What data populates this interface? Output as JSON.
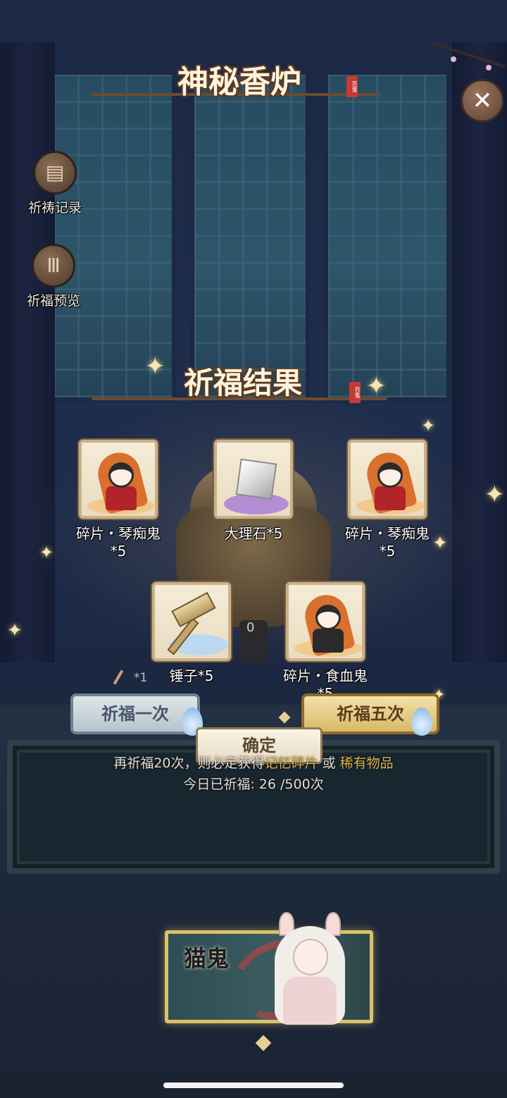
{
  "header": {
    "title": "神秘香炉",
    "seal_text": "百鬼",
    "close_label": "✕"
  },
  "side_menu": [
    {
      "id": "records",
      "label": "祈祷记录",
      "icon": "scroll-icon"
    },
    {
      "id": "preview",
      "label": "祈福预览",
      "icon": "incense-sticks-icon"
    }
  ],
  "result": {
    "title": "祈福结果",
    "seal_text": "百鬼",
    "items": [
      {
        "name": "碎片・琴痴鬼",
        "qty": "*5",
        "art": "portrait"
      },
      {
        "name": "大理石*5",
        "qty": "",
        "art": "stone"
      },
      {
        "name": "碎片・琴痴鬼",
        "qty": "*5",
        "art": "portrait"
      },
      {
        "name": "锤子*5",
        "qty": "",
        "art": "hammer"
      },
      {
        "name": "碎片・食血鬼",
        "qty": "*5",
        "art": "portrait"
      }
    ],
    "confirm_label": "确定"
  },
  "censer_counter": "0",
  "tool_counter": "*1",
  "actions": {
    "pray_once": "祈福一次",
    "pray_five": "祈福五次"
  },
  "hint": {
    "prefix": "再祈福20次，则必定获得",
    "highlight_1": "记忆碎片",
    "middle": " 或 ",
    "highlight_2": "稀有物品",
    "today_label": "今日已祈福:",
    "today_value": " 26 /500次"
  },
  "character": {
    "name": "猫鬼"
  },
  "colors": {
    "gold": "#d9b24a",
    "panel_text": "#ffffff",
    "title_text": "#fff3dd",
    "button_gold": "#d8b868",
    "button_silver": "#b7c3cc"
  }
}
